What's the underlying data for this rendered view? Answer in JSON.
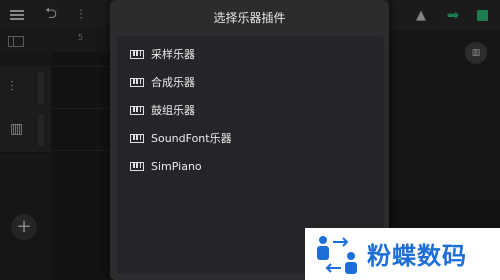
{
  "app": {
    "ruler": {
      "marker": "5",
      "marker_right": "I"
    },
    "icons": [
      "menu-icon",
      "undo-icon",
      "mixer-icon",
      "metronome-icon",
      "forward-icon",
      "record-icon",
      "grid-icon",
      "track-settings-icon",
      "piano-icon",
      "add-icon"
    ]
  },
  "dialog": {
    "title": "选择乐器插件",
    "items": [
      {
        "label": "采样乐器"
      },
      {
        "label": "合成乐器"
      },
      {
        "label": "鼓组乐器"
      },
      {
        "label": "SoundFont乐器"
      },
      {
        "label": "SimPiano"
      }
    ]
  },
  "watermark": {
    "text": "粉蝶数码"
  },
  "colors": {
    "accent": "#2fc07a",
    "watermark": "#1d6fd8",
    "dialog_bg": "#2b2c2e"
  }
}
